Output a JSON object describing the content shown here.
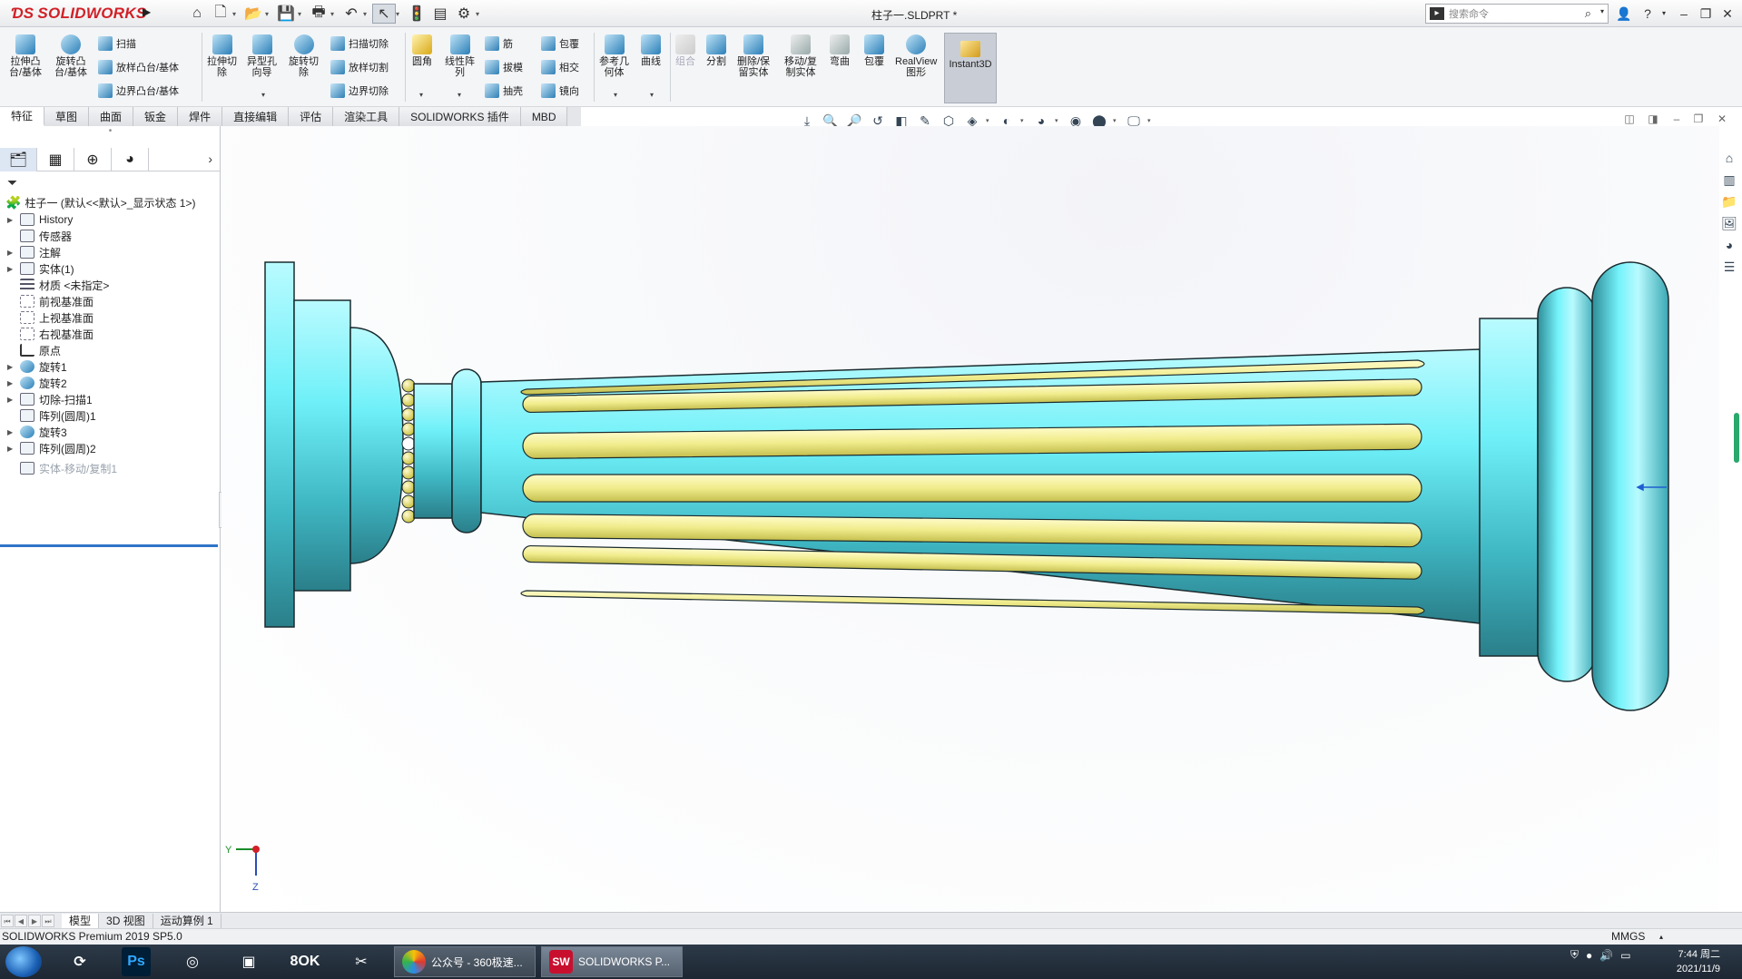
{
  "titlebar": {
    "app_name": "SOLIDWORKS",
    "document_title": "柱子一.SLDPRT *",
    "search_placeholder": "搜索命令"
  },
  "command_manager": {
    "extrude_boss": "拉伸凸\n台/基体",
    "revolve_boss": "旋转凸\n台/基体",
    "sweep": "扫描",
    "loft": "放样凸台/基体",
    "boundary": "边界凸台/基体",
    "extrude_cut": "拉伸切\n除",
    "hole_wizard": "异型孔\n向导",
    "revolve_cut": "旋转切\n除",
    "sweep_cut": "扫描切除",
    "loft_cut": "放样切割",
    "boundary_cut": "边界切除",
    "fillet": "圆角",
    "linear_pattern": "线性阵\n列",
    "rib": "筋",
    "draft": "拔模",
    "shell": "抽壳",
    "wrap": "包覆",
    "intersect": "相交",
    "mirror": "镜向",
    "ref_geometry": "参考几\n何体",
    "curves": "曲线",
    "combine": "组合",
    "split": "分割",
    "delete_keep_body": "删除/保\n留实体",
    "move_copy_body": "移动/复\n制实体",
    "flex": "弯曲",
    "wrap2": "包覆",
    "realview": "RealView\n图形",
    "instant3d": "Instant3D"
  },
  "tabs": [
    "特征",
    "草图",
    "曲面",
    "钣金",
    "焊件",
    "直接编辑",
    "评估",
    "渲染工具",
    "SOLIDWORKS 插件",
    "MBD"
  ],
  "feature_tree": {
    "root": "柱子一  (默认<<默认>_显示状态 1>)",
    "items": [
      {
        "label": "History",
        "icon": "history-icon",
        "expandable": true
      },
      {
        "label": "传感器",
        "icon": "sensor-icon",
        "expandable": false
      },
      {
        "label": "注解",
        "icon": "annotation-icon",
        "expandable": true
      },
      {
        "label": "实体(1)",
        "icon": "solid-bodies-icon",
        "expandable": true
      },
      {
        "label": "材质 <未指定>",
        "icon": "material-icon",
        "expandable": false
      },
      {
        "label": "前视基准面",
        "icon": "plane-icon",
        "expandable": false
      },
      {
        "label": "上视基准面",
        "icon": "plane-icon",
        "expandable": false
      },
      {
        "label": "右视基准面",
        "icon": "plane-icon",
        "expandable": false
      },
      {
        "label": "原点",
        "icon": "origin-icon",
        "expandable": false
      },
      {
        "label": "旋转1",
        "icon": "revolve-icon",
        "expandable": true
      },
      {
        "label": "旋转2",
        "icon": "revolve-icon",
        "expandable": true
      },
      {
        "label": "切除-扫描1",
        "icon": "sweep-cut-icon",
        "expandable": true
      },
      {
        "label": "阵列(圆周)1",
        "icon": "circular-pattern-icon",
        "expandable": false
      },
      {
        "label": "旋转3",
        "icon": "revolve-icon",
        "expandable": true
      },
      {
        "label": "阵列(圆周)2",
        "icon": "circular-pattern-icon",
        "expandable": true
      },
      {
        "label": "实体-移动/复制1",
        "icon": "move-copy-icon",
        "expandable": false
      }
    ]
  },
  "bottom_tabs": [
    "模型",
    "3D 视图",
    "运动算例 1"
  ],
  "status": {
    "product": "SOLIDWORKS Premium 2019 SP5.0",
    "units": "MMGS"
  },
  "taskbar": {
    "windows": [
      "公众号 - 360极速...",
      "SOLIDWORKS P..."
    ],
    "clock_time": "7:44 周二",
    "clock_date": "2021/11/9"
  },
  "triad": {
    "x_label": "Y",
    "z_label": "Z"
  },
  "colors": {
    "body": "#6fe8f0",
    "flutes": "#f3f08f",
    "background_top": "#eef0f4",
    "accent": "#d12027"
  }
}
